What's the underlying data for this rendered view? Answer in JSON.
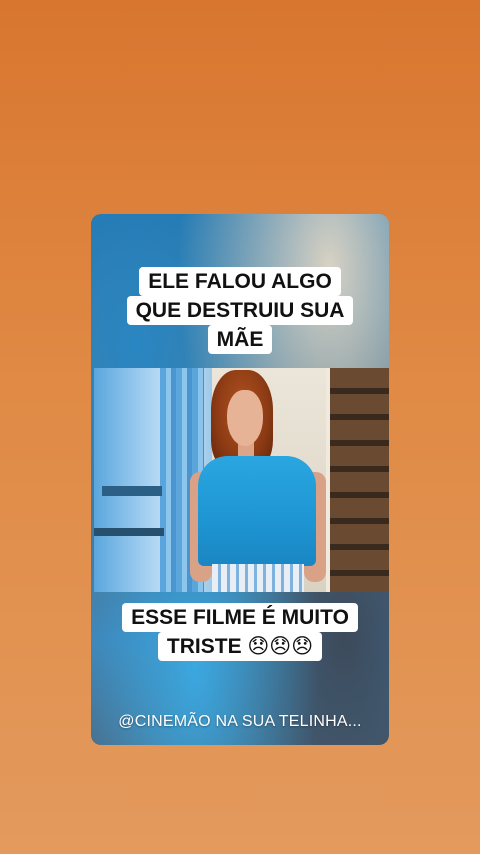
{
  "post": {
    "caption_top_lines": [
      "ELE FALOU ALGO",
      "QUE DESTRUIU SUA",
      "MÃE"
    ],
    "caption_bottom_lines": [
      "ESSE FILME É MUITO",
      "TRISTE 😞😞😞"
    ],
    "handle": "@CINEMÃO NA SUA TELINHA..."
  },
  "colors": {
    "background_top": "#d8762f",
    "background_bottom": "#e39a5d",
    "caption_bg": "#ffffff",
    "caption_text": "#111111"
  }
}
